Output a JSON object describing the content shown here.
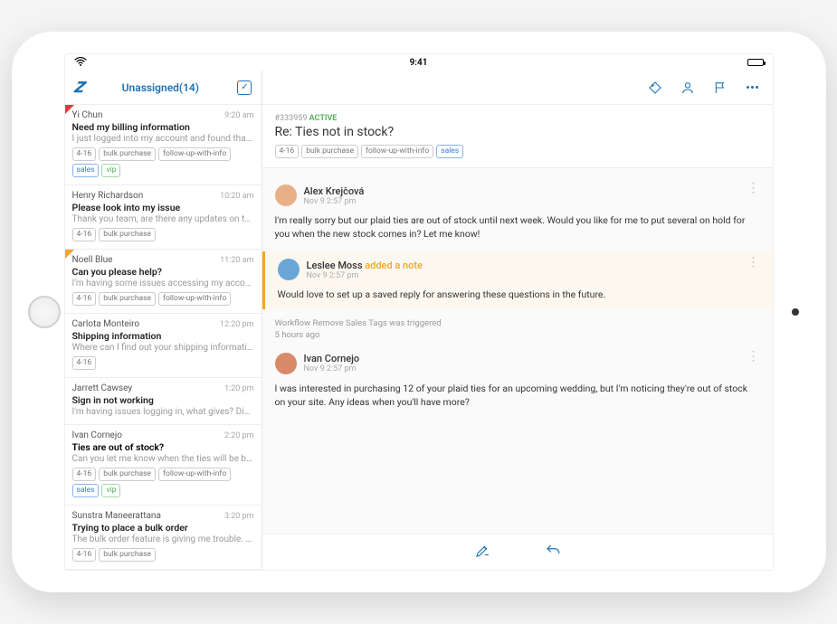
{
  "status": {
    "time": "9:41"
  },
  "sidebar": {
    "title": "Unassigned(14)",
    "items": [
      {
        "name": "Yi Chun",
        "time": "9:20 am",
        "subject": "Need my billing information",
        "preview": "I just logged into my account and found that I couldn't",
        "marker": "red",
        "tags": [
          "4-16",
          "bulk purchase",
          "follow-up-with-info",
          "sales",
          "vip"
        ]
      },
      {
        "name": "Henry Richardson",
        "time": "10:20 am",
        "subject": "Please look into my issue",
        "preview": "Thank you team, are there any updates on this issue?",
        "marker": "",
        "tags": [
          "4-16",
          "bulk purchase"
        ]
      },
      {
        "name": "Noell Blue",
        "time": "11:20 am",
        "subject": "Can you please help?",
        "preview": "I'm having some issues accessing my account. It alls",
        "marker": "yellow",
        "tags": [
          "4-16",
          "bulk purchase",
          "follow-up-with-info"
        ]
      },
      {
        "name": "Carlota Monteiro",
        "time": "12:20 pm",
        "subject": "Shipping information",
        "preview": "Where can I find out your shipping information and",
        "marker": "",
        "tags": [
          "4-16"
        ]
      },
      {
        "name": "Jarrett Cawsey",
        "time": "1:20 pm",
        "subject": "Sign in not working",
        "preview": "I'm having issues logging in, what gives? Did you",
        "marker": "",
        "tags": []
      },
      {
        "name": "Ivan Cornejo",
        "time": "2:20 pm",
        "subject": "Ties are out of stock?",
        "preview": "Can you let me know when the ties will be back in",
        "marker": "",
        "tags": [
          "4-16",
          "bulk purchase",
          "follow-up-with-info",
          "sales",
          "vip"
        ]
      },
      {
        "name": "Sunstra Maneerattana",
        "time": "3:20 pm",
        "subject": "Trying to place a bulk order",
        "preview": "The bulk order feature is giving me trouble. I need to",
        "marker": "",
        "tags": [
          "4-16",
          "bulk purchase"
        ]
      }
    ]
  },
  "ticket": {
    "id": "#333959",
    "status": "ACTIVE",
    "title": "Re: Ties not in stock?",
    "tags": [
      "4-16",
      "bulk purchase",
      "follow-up-with-info",
      "sales"
    ]
  },
  "thread": [
    {
      "type": "msg",
      "author": "Alex Krejčová",
      "time": "Nov 9 2:57 pm",
      "avatar": "a1",
      "body": "I'm really sorry but our plaid ties are out of stock until next week. Would you like for me to put several on hold for you when the new stock comes in? Let me know!"
    },
    {
      "type": "note",
      "author": "Leslee Moss",
      "note_label": "added a note",
      "time": "Nov 9 2:57 pm",
      "avatar": "a2",
      "body": "Would love to set up a saved reply for answering these questions in the future."
    },
    {
      "type": "workflow",
      "text": "Workflow Remove Sales Tags was triggered",
      "time": "5 hours ago"
    },
    {
      "type": "msg",
      "author": "Ivan Cornejo",
      "time": "Nov 9 2:57 pm",
      "avatar": "a3",
      "body": "I was interested in purchasing 12 of your plaid ties for an upcoming wedding, but I'm noticing they're out of stock on your site. Any ideas when you'll have more?"
    }
  ]
}
